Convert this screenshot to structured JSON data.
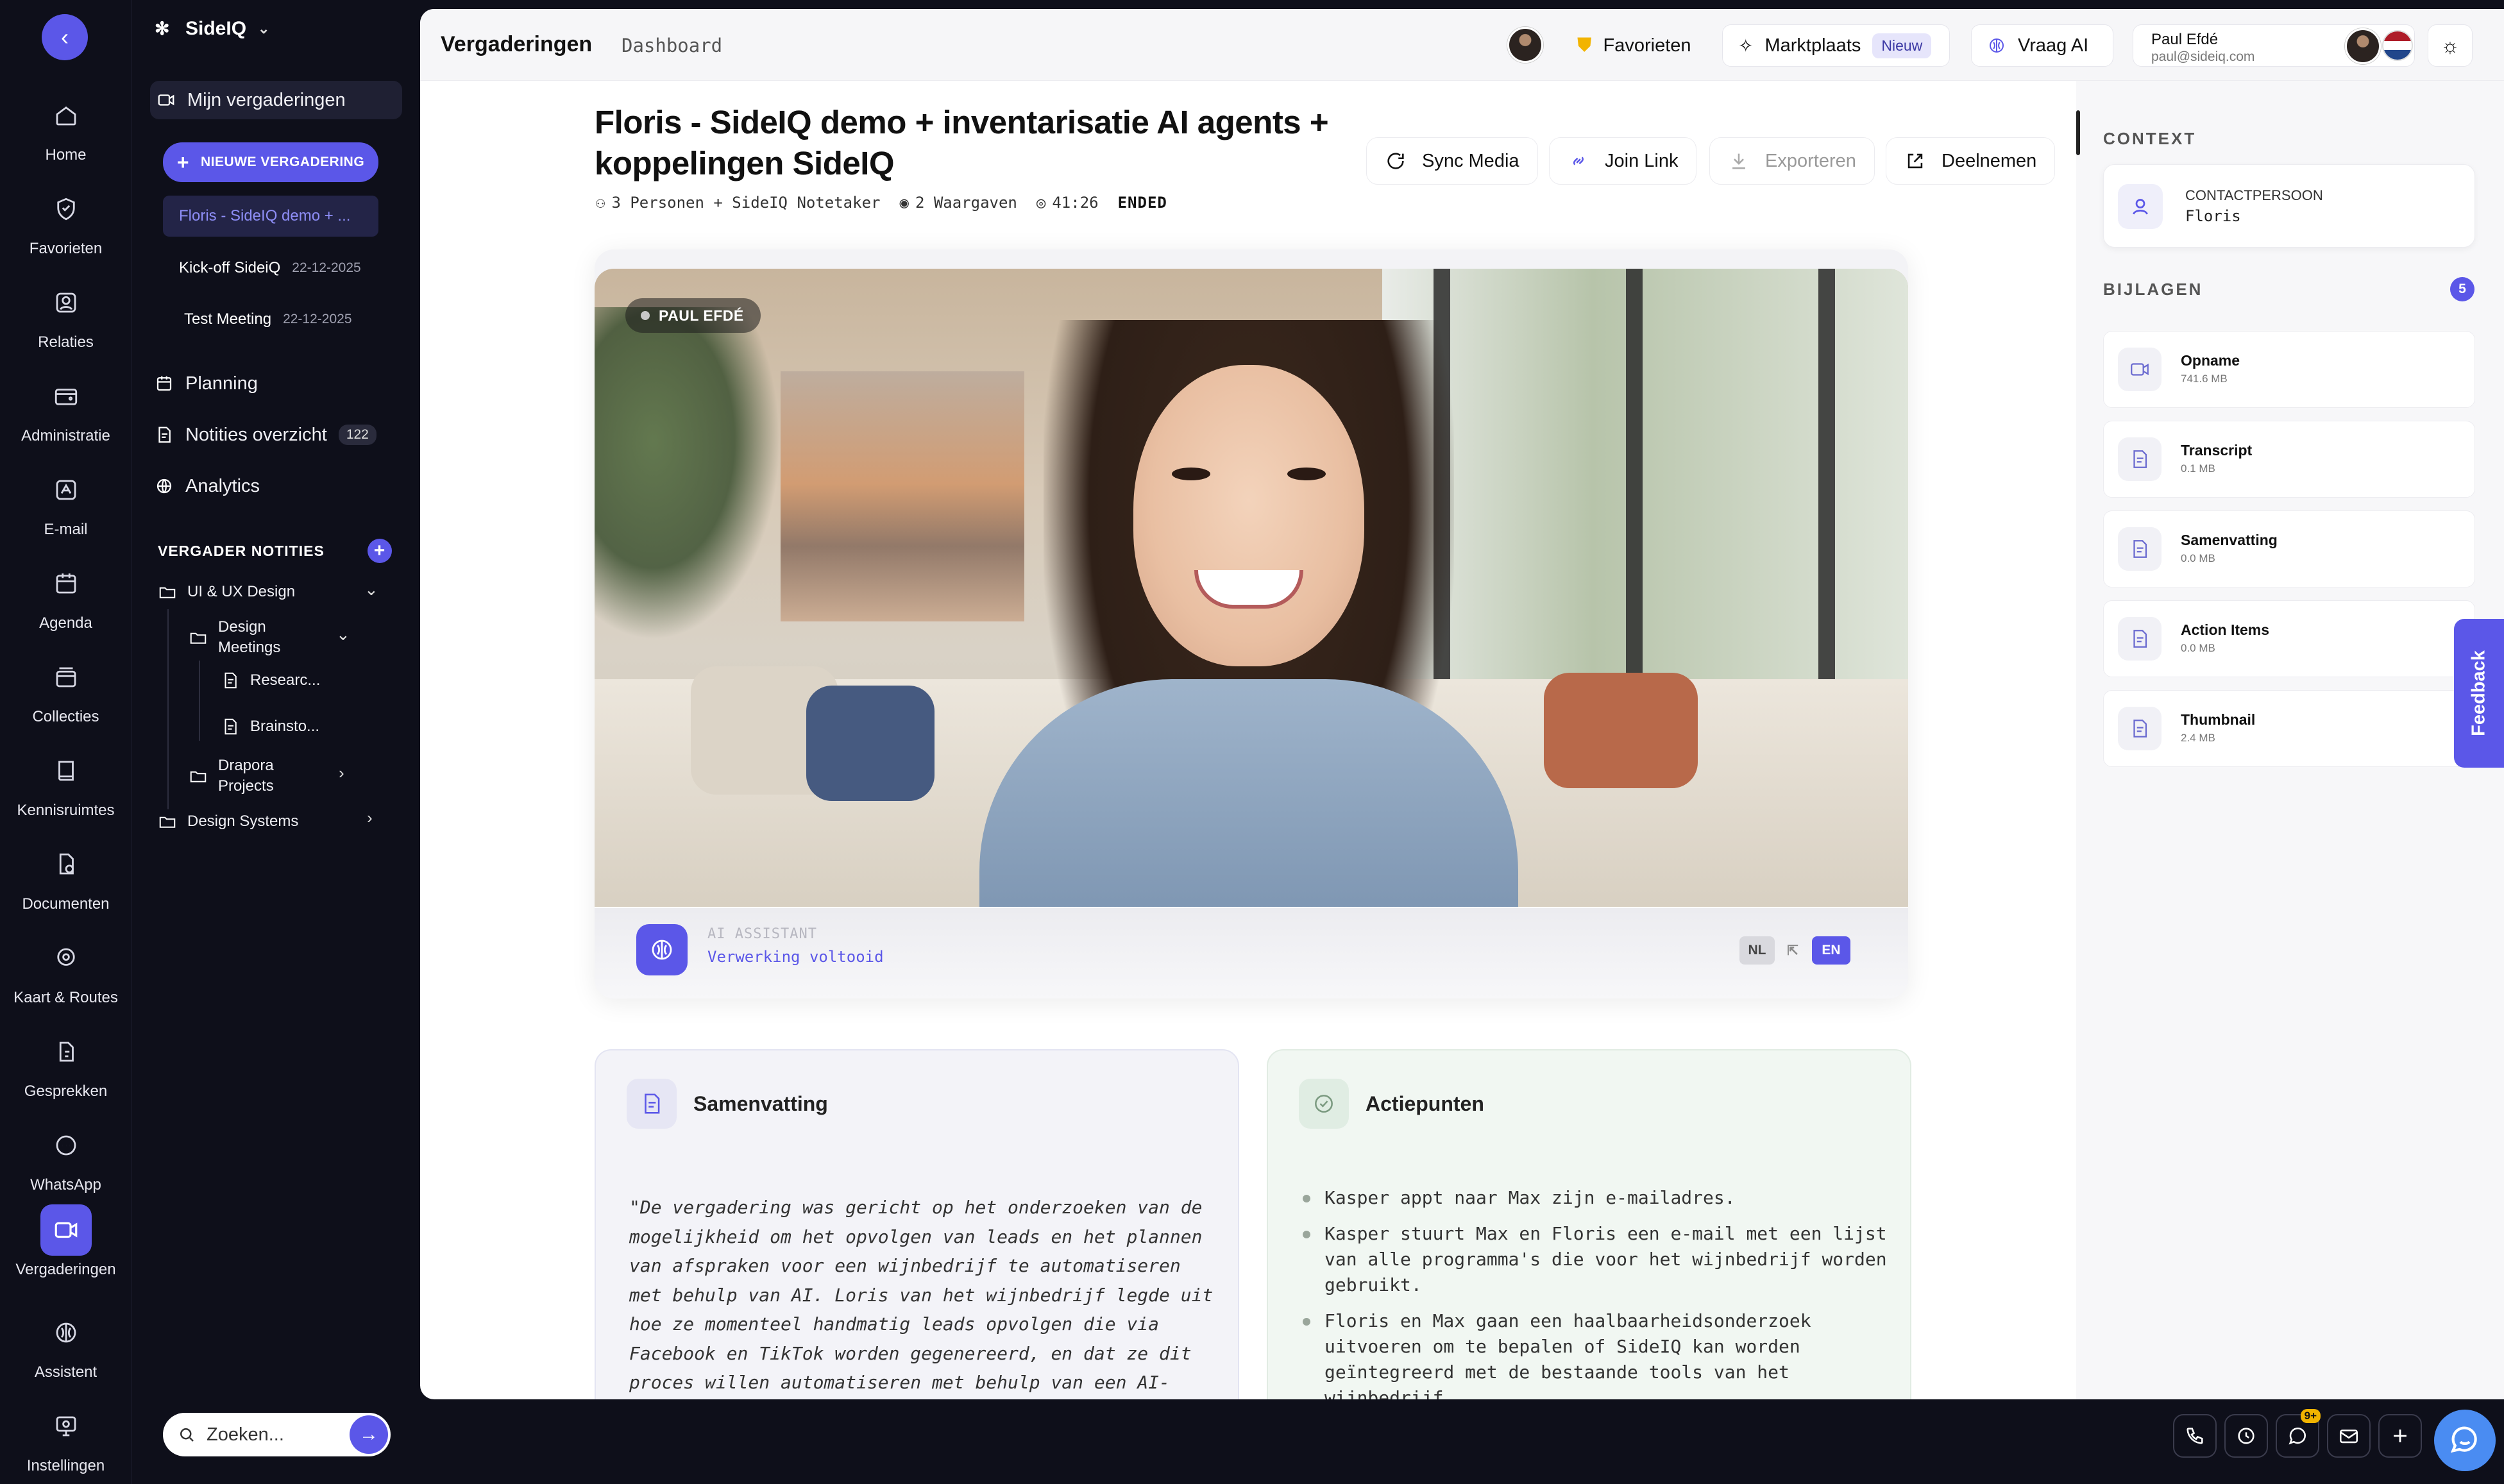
{
  "rail": {
    "items": [
      {
        "label": "Home",
        "icon": "home-icon"
      },
      {
        "label": "Favorieten",
        "icon": "shield-icon"
      },
      {
        "label": "Relaties",
        "icon": "contacts-icon"
      },
      {
        "label": "Administratie",
        "icon": "wallet-icon"
      },
      {
        "label": "E-mail",
        "icon": "mail-ai-icon"
      },
      {
        "label": "Agenda",
        "icon": "calendar-icon"
      },
      {
        "label": "Collecties",
        "icon": "collection-icon"
      },
      {
        "label": "Kennisruimtes",
        "icon": "book-icon"
      },
      {
        "label": "Documenten",
        "icon": "document-icon"
      },
      {
        "label": "Kaart & Routes",
        "icon": "map-pin-icon"
      },
      {
        "label": "Gesprekken",
        "icon": "phone-icon"
      },
      {
        "label": "WhatsApp",
        "icon": "chat-icon"
      },
      {
        "label": "Vergaderingen",
        "icon": "video-icon"
      },
      {
        "label": "Assistent",
        "icon": "brain-icon"
      },
      {
        "label": "Instellingen",
        "icon": "settings-icon"
      }
    ],
    "active": "Vergaderingen"
  },
  "sidebar": {
    "brand": "SideIQ",
    "my_meetings": "Mijn vergaderingen",
    "new_meeting": "NIEUWE VERGADERING",
    "meetings": [
      {
        "title": "Floris - SideIQ demo + ...",
        "date": ""
      },
      {
        "title": "Kick-off SideiQ",
        "date": "22-12-2025"
      },
      {
        "title": "Test Meeting",
        "date": "22-12-2025"
      }
    ],
    "planning": "Planning",
    "notes_overview": "Notities overzicht",
    "notes_count": "122",
    "analytics": "Analytics",
    "notes_section": "VERGADER NOTITIES",
    "tree": {
      "ui_ux": "UI & UX Design",
      "design_meetings_1": "Design",
      "design_meetings_2": "Meetings",
      "research": "Researc...",
      "brainstorm": "Brainsto...",
      "drapora_1": "Drapora",
      "drapora_2": "Projects",
      "design_systems": "Design Systems"
    },
    "search_placeholder": "Zoeken..."
  },
  "topbar": {
    "title": "Vergaderingen",
    "subtitle": "Dashboard",
    "favorites": "Favorieten",
    "marketplace": "Marktplaats",
    "marketplace_badge": "Nieuw",
    "ask_ai": "Vraag AI",
    "user_name": "Paul Efdé",
    "user_email": "paul@sideiq.com"
  },
  "meeting": {
    "title": "Floris - SideIQ demo + inventarisatie AI agents + koppelingen SideIQ",
    "participants": "3 Personen + SideIQ Notetaker",
    "observations": "2 Waargaven",
    "duration": "41:26",
    "status": "ENDED",
    "actions": {
      "sync": "Sync Media",
      "join": "Join Link",
      "export": "Exporteren",
      "join_meeting": "Deelnemen"
    },
    "speaker": "PAUL EFDÉ",
    "ai_label": "AI ASSISTANT",
    "ai_status": "Verwerking voltooid",
    "lang_nl": "NL",
    "lang_en": "EN"
  },
  "summary": {
    "title": "Samenvatting",
    "text": "\"De vergadering was gericht op het onderzoeken van de mogelijkheid om het opvolgen van leads en het plannen van afspraken voor een wijnbedrijf te automatiseren met behulp van AI. Loris van het wijnbedrijf legde uit hoe ze momenteel handmatig leads opvolgen die via Facebook en TikTok worden gegenereerd, en dat ze dit proces willen automatiseren met behulp van een AI-systeem. Floris en Max van SideIQ gaven aan dat dit kan"
  },
  "action_items": {
    "title": "Actiepunten",
    "items": [
      "Kasper appt naar Max zijn e-mailadres.",
      "Kasper stuurt Max en Floris een e-mail met een lijst van alle programma's die voor het wijnbedrijf worden gebruikt.",
      "Floris en Max gaan een haalbaarheidsonderzoek uitvoeren om te bepalen of SideIQ kan worden geïntegreerd met de bestaande tools van het wijnbedrijf."
    ]
  },
  "context": {
    "title": "CONTEXT",
    "contact_label": "CONTACTPERSOON",
    "contact_value": "Floris",
    "attachments_title": "BIJLAGEN",
    "attachments_count": "5",
    "attachments": [
      {
        "name": "Opname",
        "size": "741.6 MB",
        "icon": "video-file-icon"
      },
      {
        "name": "Transcript",
        "size": "0.1 MB",
        "icon": "doc-file-icon"
      },
      {
        "name": "Samenvatting",
        "size": "0.0 MB",
        "icon": "doc-file-icon"
      },
      {
        "name": "Action Items",
        "size": "0.0 MB",
        "icon": "doc-file-icon"
      },
      {
        "name": "Thumbnail",
        "size": "2.4 MB",
        "icon": "doc-file-icon"
      }
    ]
  },
  "feedback": "Feedback",
  "dock": {
    "badge": "9+"
  },
  "colors": {
    "accent": "#5b57e8",
    "rail_bg": "#0e0f1a",
    "actions_card": "#f1f7f2",
    "summary_card": "#f3f3f8"
  }
}
